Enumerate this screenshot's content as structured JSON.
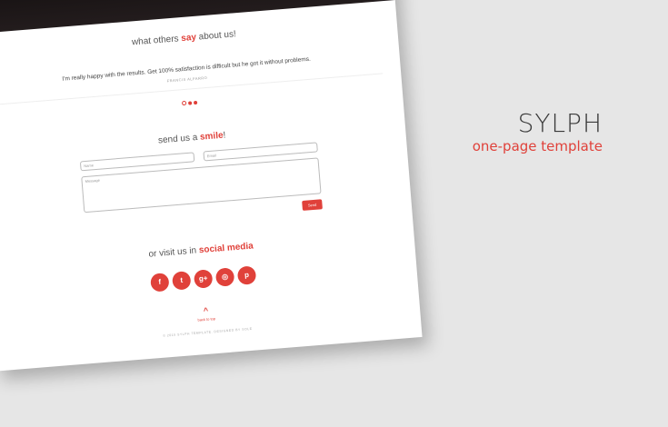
{
  "brand": {
    "title": "SYLPH",
    "subtitle": "one-page template"
  },
  "testimonials": {
    "heading_pre": "what others ",
    "heading_accent": "say",
    "heading_post": " about us!",
    "quote": "I'm really happy with the results. Get 100% satisfaction is difficult but he got it without problems.",
    "author": "FRANCIS ALFARRO",
    "active_slide": 2
  },
  "contact": {
    "heading_pre": "send us a ",
    "heading_accent": "smile",
    "heading_post": "!",
    "name_placeholder": "Name",
    "email_placeholder": "Email",
    "message_placeholder": "Message",
    "send_label": "Send"
  },
  "social": {
    "heading_pre": "or visit us in ",
    "heading_accent": "social media",
    "icons": [
      "facebook-icon",
      "twitter-icon",
      "google-plus-icon",
      "instagram-icon",
      "pinterest-icon"
    ],
    "glyphs": [
      "f",
      "t",
      "g+",
      "◎",
      "p"
    ]
  },
  "footer": {
    "back_to_top": "back to top",
    "copyright": "© 2015 SYLPH TEMPLATE. DESIGNED BY SOLE"
  },
  "colors": {
    "accent": "#e0413a",
    "background": "#e6e6e6"
  }
}
